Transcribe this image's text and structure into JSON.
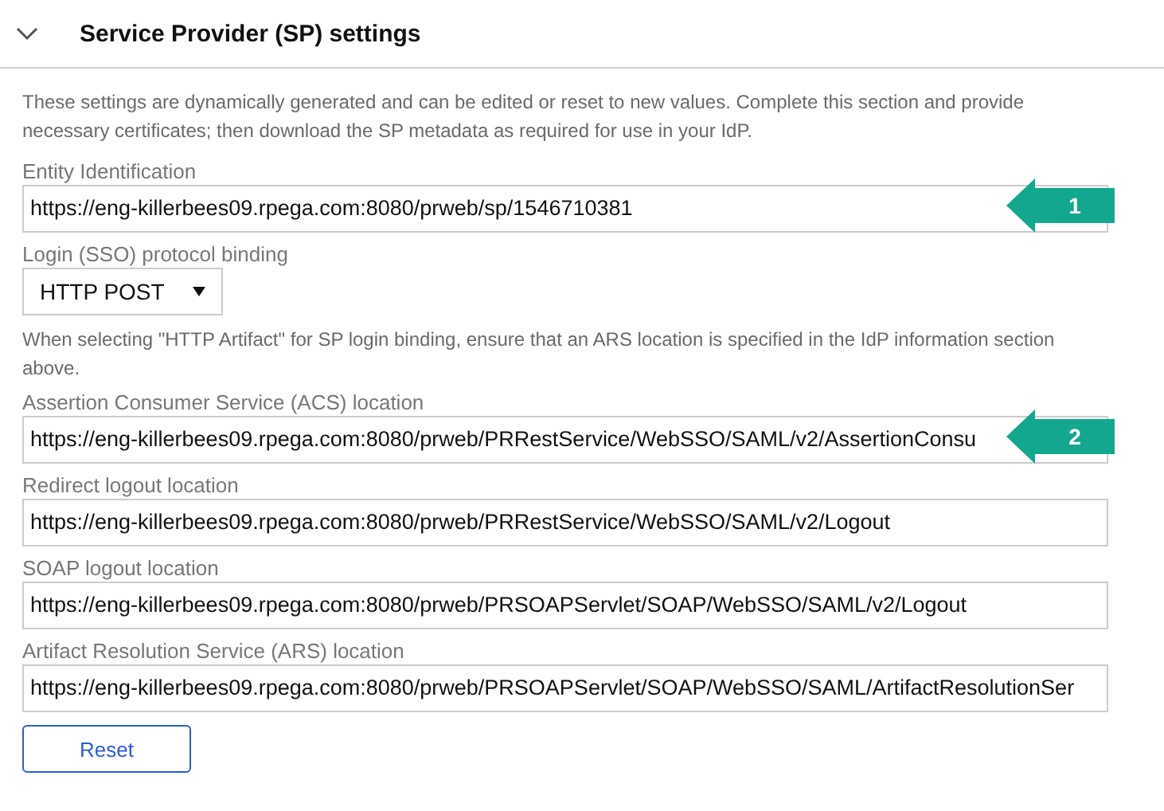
{
  "section": {
    "title": "Service Provider (SP) settings",
    "expanded": true,
    "description": "These settings are dynamically generated and can be edited or reset to new values. Complete this section and provide necessary certificates; then download the SP metadata as required for use in your IdP."
  },
  "fields": [
    {
      "kind": "text",
      "label": "Entity Identification",
      "value": "https://eng-killerbees09.rpega.com:8080/prweb/sp/1546710381",
      "callout": "1"
    },
    {
      "kind": "select",
      "label": "Login (SSO) protocol binding",
      "value": "HTTP POST"
    },
    {
      "kind": "note",
      "text": "When selecting \"HTTP Artifact\" for SP login binding, ensure that an ARS location is specified in the IdP information section above."
    },
    {
      "kind": "text",
      "label": "Assertion Consumer Service (ACS) location",
      "value": "https://eng-killerbees09.rpega.com:8080/prweb/PRRestService/WebSSO/SAML/v2/AssertionConsu",
      "callout": "2"
    },
    {
      "kind": "text",
      "label": "Redirect logout location",
      "value": "https://eng-killerbees09.rpega.com:8080/prweb/PRRestService/WebSSO/SAML/v2/Logout"
    },
    {
      "kind": "text",
      "label": "SOAP logout location",
      "value": "https://eng-killerbees09.rpega.com:8080/prweb/PRSOAPServlet/SOAP/WebSSO/SAML/v2/Logout"
    },
    {
      "kind": "text",
      "label": "Artifact Resolution Service (ARS) location",
      "value": "https://eng-killerbees09.rpega.com:8080/prweb/PRSOAPServlet/SOAP/WebSSO/SAML/ArtifactResolutionSer"
    }
  ],
  "buttons": [
    "Reset"
  ]
}
